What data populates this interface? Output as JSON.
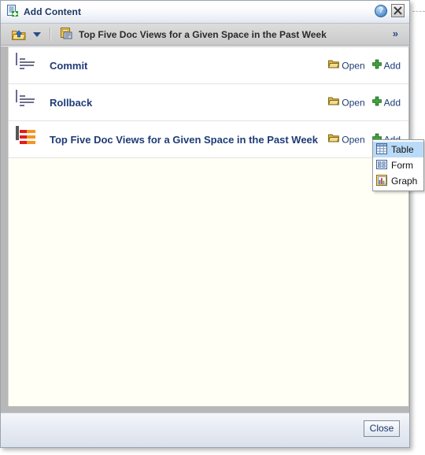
{
  "window": {
    "title": "Add Content",
    "title_icon": "add-content-icon",
    "help_icon": "help-icon",
    "help_label": "?",
    "close_icon": "close-icon"
  },
  "toolbar": {
    "folder_up_icon": "folder-up-icon",
    "dropdown_icon": "chevron-down-icon",
    "breadcrumb_icon": "catalog-item-icon",
    "breadcrumb_text": "Top Five Doc Views for a Given Space  in the Past Week",
    "overflow_icon": "double-chevron-right-icon",
    "overflow_label": "»"
  },
  "list": {
    "open_label": "Open",
    "add_label": "Add",
    "open_icon": "open-folder-icon",
    "add_icon": "green-plus-icon",
    "rows": [
      {
        "title": "Commit",
        "icon": "doc-list-icon"
      },
      {
        "title": "Rollback",
        "icon": "doc-list-icon"
      },
      {
        "title": "Top Five Doc Views for a Given Space in the Past Week",
        "icon": "bar-chart-icon"
      }
    ]
  },
  "popup_menu": {
    "items": [
      {
        "label": "Table",
        "icon": "table-icon",
        "selected": true
      },
      {
        "label": "Form",
        "icon": "form-icon",
        "selected": false
      },
      {
        "label": "Graph",
        "icon": "graph-icon",
        "selected": false
      }
    ]
  },
  "footer": {
    "close_label": "Close"
  },
  "colors": {
    "title_text": "#1f3864",
    "link_text": "#1f3b77",
    "menu_highlight": "#b9dbf7",
    "accent_green": "#36a036",
    "accent_orange": "#f79422",
    "accent_red": "#e51b18"
  }
}
